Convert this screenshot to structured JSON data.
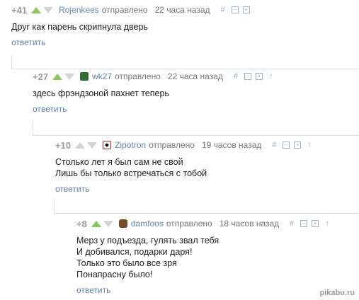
{
  "comments": [
    {
      "score": "+41",
      "username": "Rojenkees",
      "sent_label": "отправлено",
      "time": "22 часа назад",
      "text": "Друг как парень скрипнула дверь",
      "reply_label": "ответить",
      "avatar": "none",
      "has_parent_link": false
    },
    {
      "score": "+27",
      "username": "wk27",
      "sent_label": "отправлено",
      "time": "22 часа назад",
      "text": "здесь фрэндзоной пахнет теперь",
      "reply_label": "ответить",
      "avatar": "green-square",
      "has_parent_link": true
    },
    {
      "score": "+10",
      "username": "Zipotron",
      "sent_label": "отправлено",
      "time": "19 часов назад",
      "text": "Столько лет я был сам не свой\nЛишь бы только встречаться с тобой",
      "reply_label": "ответить",
      "avatar": "swastika-badge",
      "has_parent_link": true
    },
    {
      "score": "+8",
      "username": "damfoos",
      "sent_label": "отправлено",
      "time": "18 часов назад",
      "text": "Мерз у подъезда, гулять звал тебя\nИ добивался, подарки даря!\nТолько это было все зря\nПонапрасну было!",
      "reply_label": "ответить",
      "avatar": "dog-photo",
      "has_parent_link": true
    }
  ],
  "icons": {
    "link": "hash-icon",
    "collapse": "minus-box-icon",
    "save": "save-icon",
    "parent": "arrow-up-icon"
  },
  "watermark": "pikabu.ru",
  "colors": {
    "upvote": "#8ac858",
    "downvote": "#cfd4d9",
    "link": "#5f84b9",
    "thread_line": "#d9dfe5"
  }
}
